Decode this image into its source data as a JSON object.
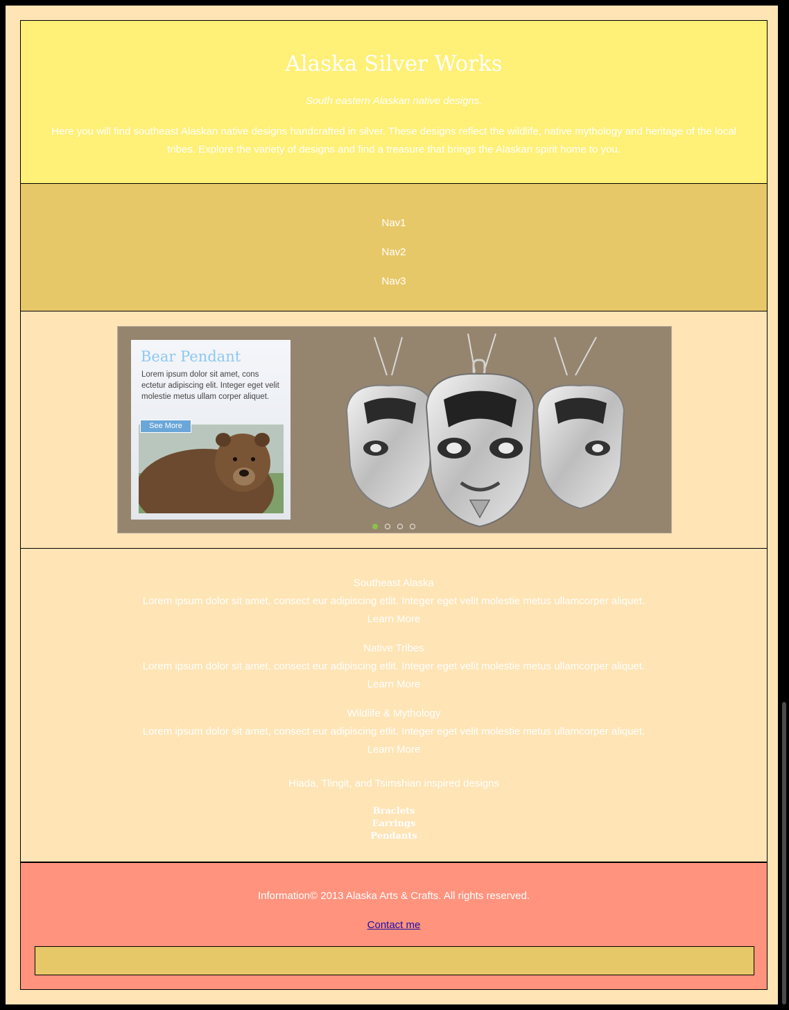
{
  "header": {
    "title": "Alaska Silver Works",
    "tagline": "South eastern Alaskan native designs.",
    "intro": "Here you will find southeast Alaskan native designs handcrafted in silver. These designs reflect the wildlife, native mythology and heritage of the local tribes. Explore the variety of designs and find a treasure that brings the Alaskan spirit home to you."
  },
  "nav": {
    "items": [
      {
        "label": "Nav1"
      },
      {
        "label": "Nav2"
      },
      {
        "label": "Nav3"
      }
    ]
  },
  "banner": {
    "promo_title": "Bear Pendant",
    "promo_text": "Lorem ipsum dolor sit amet, cons ectetur adipiscing elit. Integer eget velit molestie metus ullam corper aliquet.",
    "promo_button": "See More",
    "slides_total": 4,
    "active_slide": 1,
    "colors": {
      "banner_bg": "#96856e",
      "active_dot": "#8bc34a"
    }
  },
  "content": {
    "topics": [
      {
        "heading": "Southeast Alaska",
        "body": "Lorem ipsum dolor sit amet, consect eur adipiscing etlit. Integer eget velit molestie metus ullamcorper aliquet.",
        "link": "Learn More"
      },
      {
        "heading": "Native Tribes",
        "body": "Lorem ipsum dolor sit amet, consect eur adipiscing etlit. Integer eget velit molestie metus ullamcorper aliquet.",
        "link": "Learn More"
      },
      {
        "heading": "Wildlife & Mythology",
        "body": "Lorem ipsum dolor sit amet, consect eur adipiscing etlit. Integer eget velit molestie metus ullamcorper aliquet.",
        "link": "Learn More"
      }
    ],
    "inspired": "Hiada, Tlingit, and Tsimshian inspired designs",
    "categories": [
      {
        "label": "Braclets"
      },
      {
        "label": "Earrings"
      },
      {
        "label": "Pendants"
      }
    ]
  },
  "footer": {
    "info": "Information© 2013 Alaska Arts & Crafts. All rights reserved.",
    "contact": "Contact me"
  },
  "colors": {
    "page_bg": "#ffe4b5",
    "header_bg": "#fff077",
    "nav_bg": "#e7c869",
    "footer_bg": "#ff937d",
    "link": "#1a0dab"
  }
}
